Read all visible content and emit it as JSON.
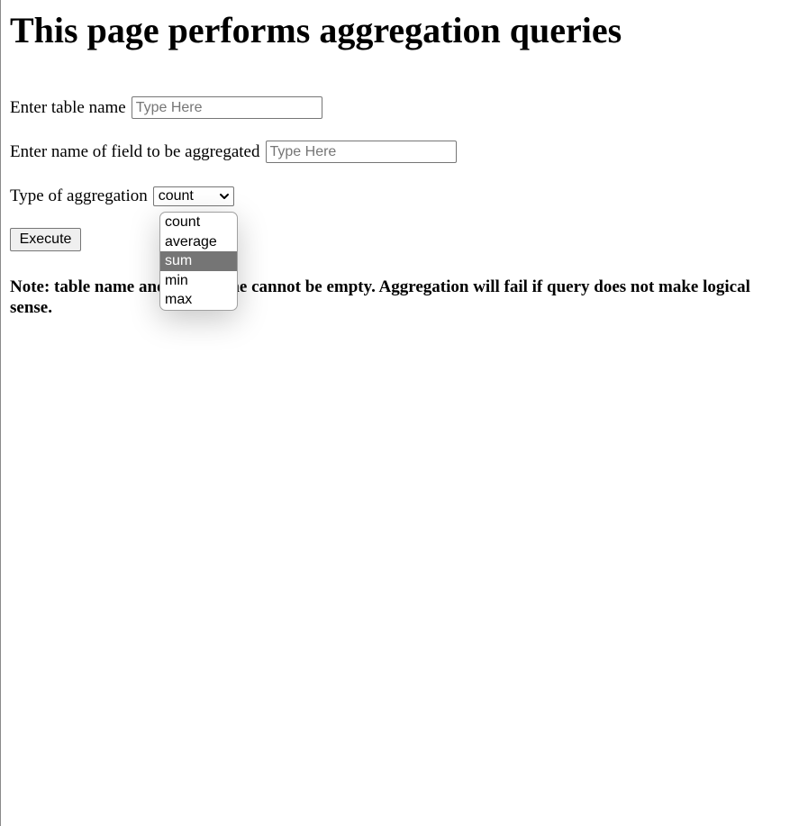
{
  "page": {
    "heading": "This page performs aggregation queries"
  },
  "form": {
    "table_label": "Enter table name",
    "table_placeholder": "Type Here",
    "table_value": "",
    "field_label": "Enter name of field to be aggregated",
    "field_placeholder": "Type Here",
    "field_value": "",
    "aggregation_label": "Type of aggregation",
    "aggregation_selected": "count",
    "execute_label": "Execute"
  },
  "dropdown": {
    "options": [
      "count",
      "average",
      "sum",
      "min",
      "max"
    ],
    "highlighted": "sum"
  },
  "note": "Note: table name and field name cannot be empty. Aggregation will fail if query does not make logical sense.",
  "colors": {
    "highlight_bg": "#757575",
    "border": "#767676"
  }
}
